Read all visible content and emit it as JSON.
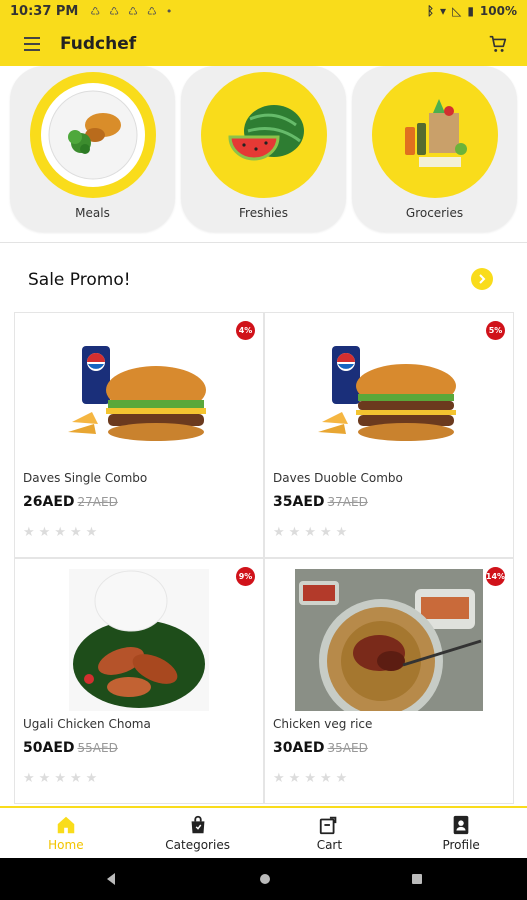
{
  "status_bar": {
    "time": "10:37 PM",
    "battery": "100%"
  },
  "app_bar": {
    "title": "Fudchef"
  },
  "categories": [
    {
      "label": "Meals",
      "icon": "meals-icon"
    },
    {
      "label": "Freshies",
      "icon": "watermelon-icon"
    },
    {
      "label": "Groceries",
      "icon": "groceries-icon"
    }
  ],
  "section": {
    "title": "Sale Promo!"
  },
  "products": [
    {
      "name": "Daves Single Combo",
      "price": "26AED",
      "old_price": "27AED",
      "discount": "4%",
      "rating": 0
    },
    {
      "name": "Daves Duoble Combo",
      "price": "35AED",
      "old_price": "37AED",
      "discount": "5%",
      "rating": 0
    },
    {
      "name": "Ugali Chicken Choma",
      "price": "50AED",
      "old_price": "55AED",
      "discount": "9%",
      "rating": 0
    },
    {
      "name": "Chicken veg rice",
      "price": "30AED",
      "old_price": "35AED",
      "discount": "14%",
      "rating": 0
    }
  ],
  "bottom_nav": [
    {
      "label": "Home",
      "icon": "home-icon",
      "active": true
    },
    {
      "label": "Categories",
      "icon": "bag-icon",
      "active": false
    },
    {
      "label": "Cart",
      "icon": "cart-icon",
      "active": false
    },
    {
      "label": "Profile",
      "icon": "profile-icon",
      "active": false
    }
  ],
  "colors": {
    "accent": "#f9dc1b",
    "badge": "#d0121a",
    "active_nav": "#f2c400"
  }
}
